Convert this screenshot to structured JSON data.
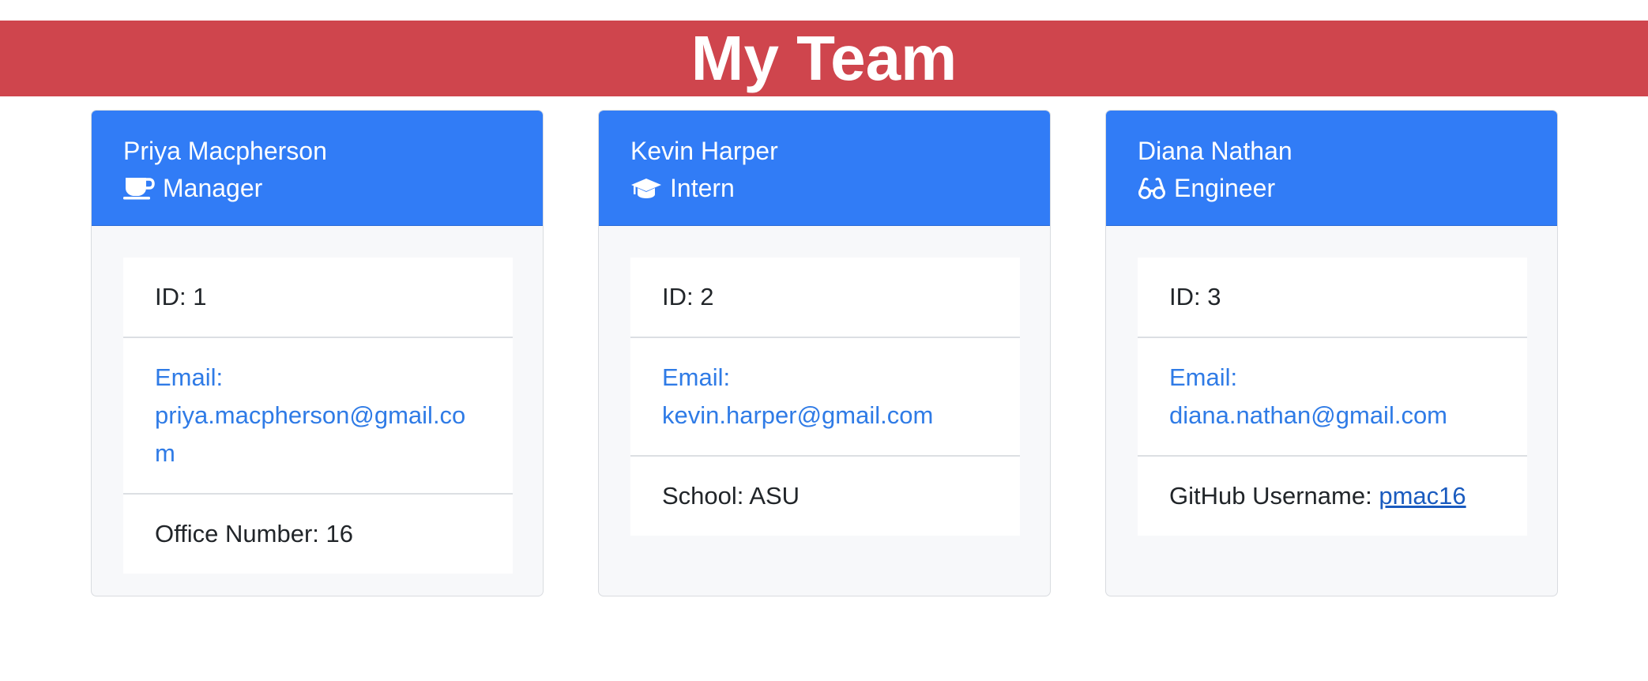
{
  "header": {
    "title": "My Team"
  },
  "team": [
    {
      "name": "Priya Macpherson",
      "role": "Manager",
      "role_icon": "coffee-cup-icon",
      "id_text": "ID: 1",
      "email_label": "Email:",
      "email": "priya.macpherson@gmail.com",
      "extra_label": "Office Number:",
      "extra_value": "16"
    },
    {
      "name": "Kevin Harper",
      "role": "Intern",
      "role_icon": "graduation-cap-icon",
      "id_text": "ID: 2",
      "email_label": "Email:",
      "email": "kevin.harper@gmail.com",
      "extra_label": "School:",
      "extra_value": "ASU"
    },
    {
      "name": "Diana Nathan",
      "role": "Engineer",
      "role_icon": "glasses-icon",
      "id_text": "ID: 3",
      "email_label": "Email:",
      "email": "diana.nathan@gmail.com",
      "extra_label": "GitHub Username:",
      "extra_value": "pmac16"
    }
  ],
  "colors": {
    "banner": "#cf454d",
    "card_header": "#317cf6",
    "link": "#2f7be6"
  }
}
